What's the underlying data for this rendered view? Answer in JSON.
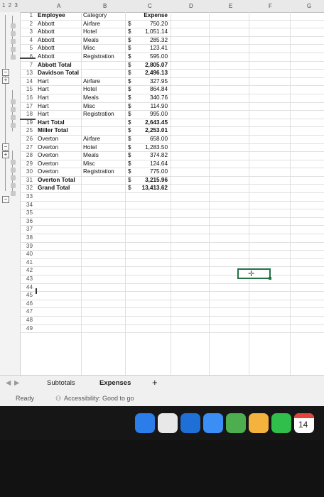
{
  "outline_levels": "1 2 3",
  "columns": [
    "A",
    "B",
    "C",
    "D",
    "E",
    "F",
    "G"
  ],
  "table": {
    "headers": {
      "employee": "Employee",
      "category": "Category",
      "expense": "Expense"
    },
    "rows": [
      {
        "n": "1",
        "a": "Employee",
        "b": "Category",
        "d": "",
        "v": "Expense",
        "bold": true
      },
      {
        "n": "2",
        "a": "Abbott",
        "b": "Airfare",
        "d": "$",
        "v": "750.20"
      },
      {
        "n": "3",
        "a": "Abbott",
        "b": "Hotel",
        "d": "$",
        "v": "1,051.14"
      },
      {
        "n": "4",
        "a": "Abbott",
        "b": "Meals",
        "d": "$",
        "v": "285.32"
      },
      {
        "n": "5",
        "a": "Abbott",
        "b": "Misc",
        "d": "$",
        "v": "123.41"
      },
      {
        "n": "6",
        "a": "Abbott",
        "b": "Registration",
        "d": "$",
        "v": "595.00"
      },
      {
        "n": "7",
        "a": "Abbott Total",
        "b": "",
        "d": "$",
        "v": "2,805.07",
        "bold": true
      },
      {
        "n": "13",
        "a": "Davidson Total",
        "b": "",
        "d": "$",
        "v": "2,496.13",
        "bold": true
      },
      {
        "n": "14",
        "a": "Hart",
        "b": "Airfare",
        "d": "$",
        "v": "327.95"
      },
      {
        "n": "15",
        "a": "Hart",
        "b": "Hotel",
        "d": "$",
        "v": "864.84"
      },
      {
        "n": "16",
        "a": "Hart",
        "b": "Meals",
        "d": "$",
        "v": "340.76"
      },
      {
        "n": "17",
        "a": "Hart",
        "b": "Misc",
        "d": "$",
        "v": "114.90"
      },
      {
        "n": "18",
        "a": "Hart",
        "b": "Registration",
        "d": "$",
        "v": "995.00"
      },
      {
        "n": "19",
        "a": "Hart Total",
        "b": "",
        "d": "$",
        "v": "2,643.45",
        "bold": true
      },
      {
        "n": "25",
        "a": "Miller Total",
        "b": "",
        "d": "$",
        "v": "2,253.01",
        "bold": true
      },
      {
        "n": "26",
        "a": "Overton",
        "b": "Airfare",
        "d": "$",
        "v": "658.00"
      },
      {
        "n": "27",
        "a": "Overton",
        "b": "Hotel",
        "d": "$",
        "v": "1,283.50"
      },
      {
        "n": "28",
        "a": "Overton",
        "b": "Meals",
        "d": "$",
        "v": "374.82"
      },
      {
        "n": "29",
        "a": "Overton",
        "b": "Misc",
        "d": "$",
        "v": "124.64"
      },
      {
        "n": "30",
        "a": "Overton",
        "b": "Registration",
        "d": "$",
        "v": "775.00"
      },
      {
        "n": "31",
        "a": "Overton Total",
        "b": "",
        "d": "$",
        "v": "3,215.96",
        "bold": true
      },
      {
        "n": "32",
        "a": "Grand Total",
        "b": "",
        "d": "$",
        "v": "13,413.62",
        "bold": true
      },
      {
        "n": "33"
      },
      {
        "n": "34"
      },
      {
        "n": "35"
      },
      {
        "n": "36"
      },
      {
        "n": "37"
      },
      {
        "n": "38"
      },
      {
        "n": "39"
      },
      {
        "n": "40"
      },
      {
        "n": "41"
      },
      {
        "n": "42"
      },
      {
        "n": "43"
      },
      {
        "n": "44"
      },
      {
        "n": "45"
      },
      {
        "n": "46"
      },
      {
        "n": "47"
      },
      {
        "n": "48"
      },
      {
        "n": "49"
      }
    ]
  },
  "sheet_tabs": {
    "active": "Subtotals",
    "second": "Expenses",
    "add": "+"
  },
  "status": {
    "ready": "Ready",
    "accessibility": "Accessibility: Good to go"
  },
  "dock": {
    "icons": [
      "finder-icon",
      "launchpad-icon",
      "safari-icon",
      "mail-icon",
      "maps-icon",
      "photos-icon",
      "facetime-icon",
      "calendar-icon"
    ],
    "colors": [
      "#2b7de9",
      "#e8e8e8",
      "#1e6fd6",
      "#3a8ef6",
      "#4cae4f",
      "#f3b33d",
      "#2fbf4a",
      "#ffffff"
    ],
    "calendar_day": "14"
  }
}
